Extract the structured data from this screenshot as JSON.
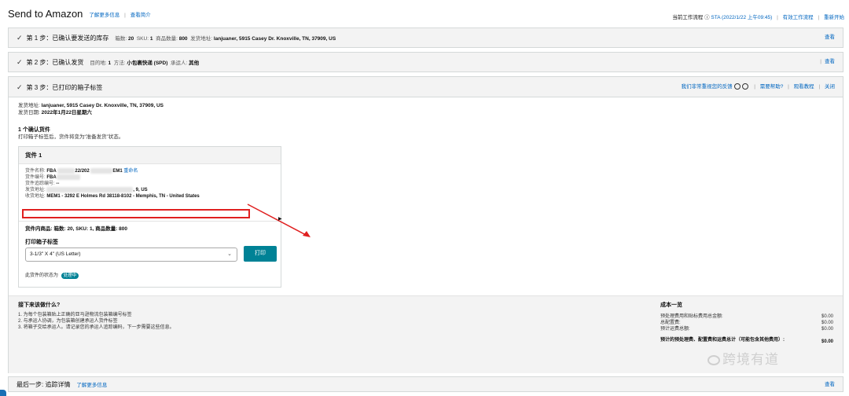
{
  "header": {
    "title": "Send to Amazon",
    "learn_more": "了解更多信息",
    "view_intro": "查看简介",
    "current_workflow_label": "当前工作流程",
    "current_workflow_value": "STA (2022/1/22 上午09:45)",
    "active_workflows": "有效工作流程",
    "restart": "重新开始"
  },
  "step1": {
    "title": "第 1 步：已确认要发送的库存",
    "boxes_label": "箱数:",
    "boxes_value": "20",
    "sku_label": "SKU:",
    "sku_value": "1",
    "qty_label": "商品数量:",
    "qty_value": "800",
    "ship_from_label": "发货地址:",
    "ship_from_value": "lanjuaner, 5915 Casey Dr.  Knoxville, TN, 37909, US",
    "view": "查看"
  },
  "step2": {
    "title": "第 2 步：已确认发货",
    "dest_label": "目的地:",
    "dest_value": "1",
    "method_label": "方法:",
    "method_value": "小包裹快递 (SPD)",
    "carrier_label": "承运人:",
    "carrier_value": "其他",
    "view": "查看"
  },
  "step3": {
    "title": "第 3 步：已打印的箱子标签",
    "feedback": "我们非常重视您的反馈",
    "need_help": "需要帮助?",
    "watch_tutorial": "观看教程",
    "close": "关闭",
    "ship_from_label": "发货地址:",
    "ship_from_value": "lanjuaner, 5915 Casey Dr.  Knoxville, TN, 37909, US",
    "ship_date_label": "发货日期:",
    "ship_date_value": "2022年1月22日星期六",
    "confirmed_title": "1 个确认货件",
    "confirmed_desc": "打印箱子标签后，货件将变为“准备发货”状态。"
  },
  "shipment": {
    "header": "货件 1",
    "name_label": "货件名称:",
    "name_value_start": "FBA",
    "name_value_mid": "22/202",
    "name_value_end": "EM1",
    "rename": "重命名",
    "id_label": "货件编号:",
    "id_value": "FBA",
    "tracking_label": "货件追踪编号:",
    "tracking_value": "--",
    "from_label": "发货地址:",
    "from_value_end": ", 9, US",
    "to_label": "收货地址:",
    "to_value": "MEM1 - 3292 E Holmes Rd  38118-8102 - Memphis, TN - United States",
    "contents": "货件内商品: 箱数: 20, SKU: 1, 商品数量: 800",
    "print_label_title": "打印箱子标签",
    "select_value": "3-1/3\" X 4\" (US Letter)",
    "print_button": "打印",
    "status_text": "此货件的状态为",
    "status_badge": "处理中"
  },
  "next_steps": {
    "title": "接下来该做什么?",
    "items": [
      "1. 为每个包装箱贴上正确的亚马逊物流包装箱编号标签",
      "2. 与承运人协调，为包装箱创建承运人货件标签",
      "3. 将箱子交给承运人。请记录您的承运人追踪编码，下一步需要这些信息。"
    ]
  },
  "cost": {
    "title": "成本一览",
    "rows": [
      {
        "label": "预处理费用和贴标费用总金额:",
        "amount": "$0.00"
      },
      {
        "label": "总配置费:",
        "amount": "$0.00"
      },
      {
        "label": "预计运费总额:",
        "amount": "$0.00"
      }
    ],
    "total_label": "预计的预处理费、配置费和运费总计（可能包含其他费用）:",
    "total_amount": "$0.00"
  },
  "final_step": {
    "title": "最后一步: 追踪详情",
    "learn_more": "了解更多信息",
    "view": "查看"
  },
  "watermark": "跨境有道",
  "colors": {
    "accent": "#008296",
    "link": "#0066c0",
    "highlight": "#e02020"
  }
}
